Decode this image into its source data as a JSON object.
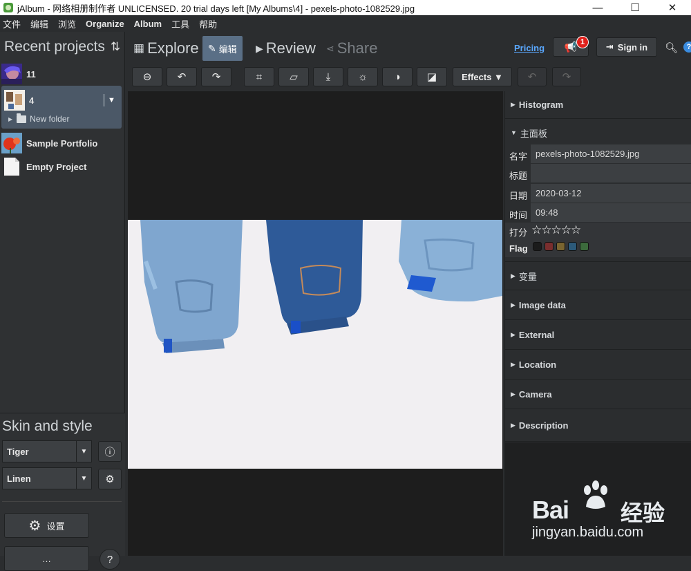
{
  "window": {
    "title": "jAlbum - 网络相册制作者 UNLICENSED. 20 trial days left [My Albums\\4] - pexels-photo-1082529.jpg",
    "minimize": "—",
    "maximize": "☐",
    "close": "✕"
  },
  "menu": [
    "文件",
    "编辑",
    "浏览",
    "Organize",
    "Album",
    "工具",
    "帮助"
  ],
  "left": {
    "recent_title": "Recent projects",
    "sort_icon": "⇅",
    "projects": [
      {
        "label": "11"
      },
      {
        "label": "4",
        "subfolder": "New folder"
      },
      {
        "label": "Sample Portfolio"
      },
      {
        "label": "Empty Project"
      }
    ],
    "skin_title": "Skin and style",
    "skin_value": "Tiger",
    "style_value": "Linen",
    "settings_label": "设置",
    "second_label": "…"
  },
  "nav": {
    "explore": "Explore",
    "edit": "编辑",
    "review": "Review",
    "share": "Share",
    "pricing": "Pricing",
    "badge_count": "1",
    "sign_in": "Sign in",
    "help": "?"
  },
  "toolbar": {
    "effects": "Effects ▼"
  },
  "right": {
    "histogram": "Histogram",
    "main_panel": "主面板",
    "fields": {
      "name_label": "名字",
      "name_value": "pexels-photo-1082529.jpg",
      "title_label": "标题",
      "title_value": "",
      "date_label": "日期",
      "date_value": "2020-03-12",
      "time_label": "时间",
      "time_value": "09:48",
      "rating_label": "打分",
      "rating_stars": "☆☆☆☆☆",
      "flag_label": "Flag"
    },
    "flag_colors": [
      "#1b1b1b",
      "#7a2e2e",
      "#7a6530",
      "#2c5a7a",
      "#3c6b3c"
    ],
    "sections": [
      "变量",
      "Image data",
      "External",
      "Location",
      "Camera",
      "Description"
    ]
  },
  "watermark": {
    "brand": "Bai",
    "brand_cn": "经验",
    "url": "jingyan.baidu.com"
  }
}
